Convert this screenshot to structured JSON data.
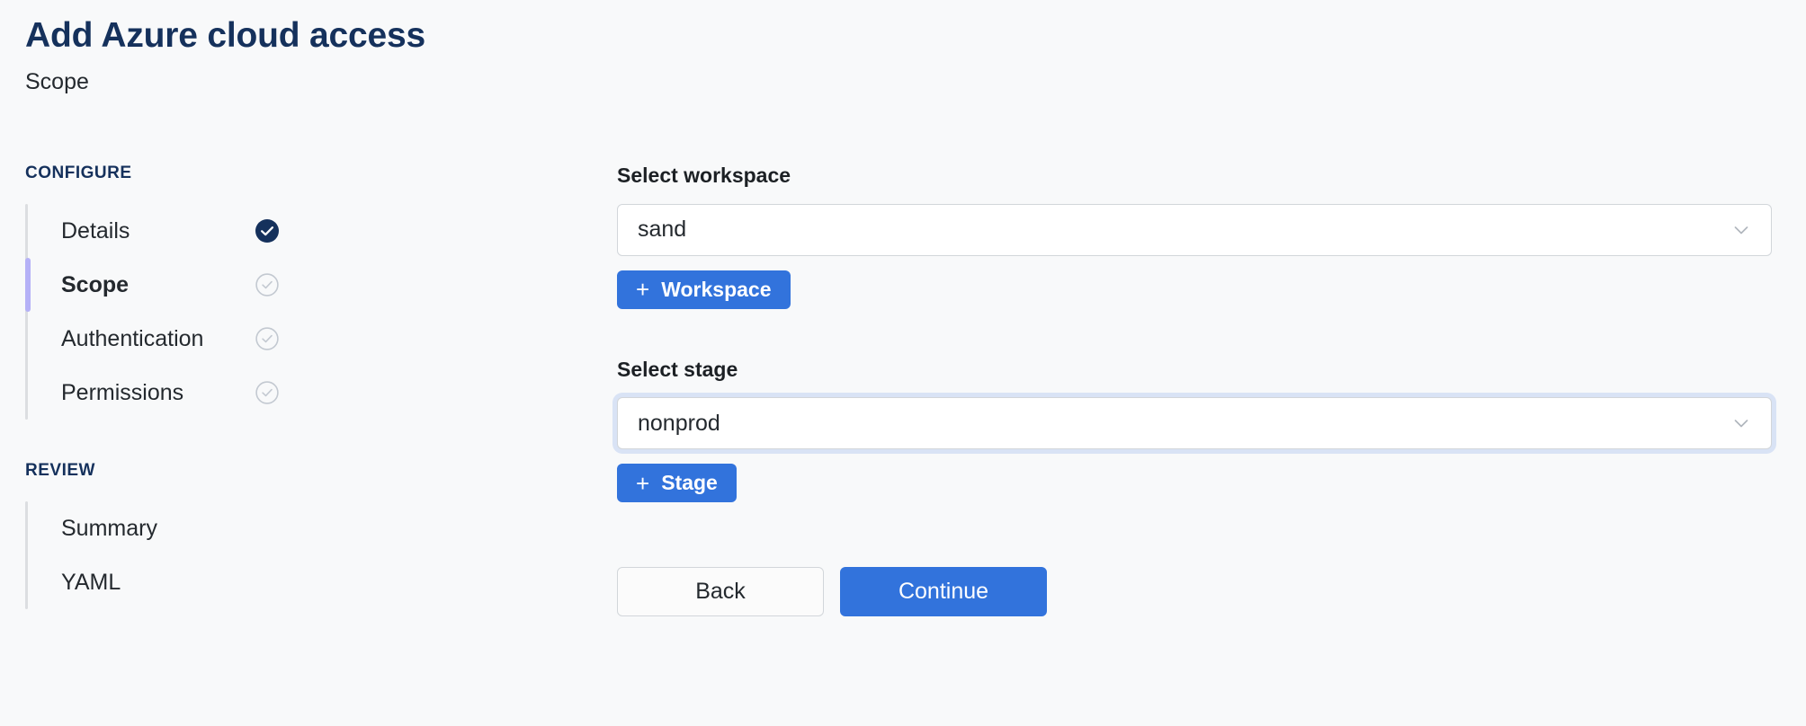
{
  "header": {
    "title": "Add Azure cloud access",
    "subtitle": "Scope"
  },
  "colors": {
    "page_background": "#f8f9fa",
    "title_navy": "#15315c",
    "accent_blue": "#3273dc",
    "active_step_bar": "#b5b1f7",
    "track_gray": "#dcdee1",
    "focus_ring": "#d9e3f5",
    "check_done_fill": "#15315c",
    "check_pending_stroke": "#c3c9d1"
  },
  "stepnav": {
    "groups": [
      {
        "label": "CONFIGURE",
        "items": [
          {
            "label": "Details",
            "state": "done",
            "active": false,
            "icon": "check-circle-filled-icon"
          },
          {
            "label": "Scope",
            "state": "pending",
            "active": true,
            "icon": "check-circle-outline-icon"
          },
          {
            "label": "Authentication",
            "state": "pending",
            "active": false,
            "icon": "check-circle-outline-icon"
          },
          {
            "label": "Permissions",
            "state": "pending",
            "active": false,
            "icon": "check-circle-outline-icon"
          }
        ]
      },
      {
        "label": "REVIEW",
        "items": [
          {
            "label": "Summary",
            "state": "none",
            "active": false,
            "icon": ""
          },
          {
            "label": "YAML",
            "state": "none",
            "active": false,
            "icon": ""
          }
        ]
      }
    ]
  },
  "form": {
    "workspace": {
      "label": "Select workspace",
      "value": "sand",
      "placeholder": "Select workspace",
      "focused": false,
      "chevron_icon": "chevron-down-icon",
      "add_button": {
        "label": "Workspace",
        "plus": "+"
      }
    },
    "stage": {
      "label": "Select stage",
      "value": "nonprod",
      "placeholder": "Select stage",
      "focused": true,
      "chevron_icon": "chevron-down-icon",
      "add_button": {
        "label": "Stage",
        "plus": "+"
      }
    },
    "actions": {
      "back_label": "Back",
      "continue_label": "Continue"
    }
  }
}
